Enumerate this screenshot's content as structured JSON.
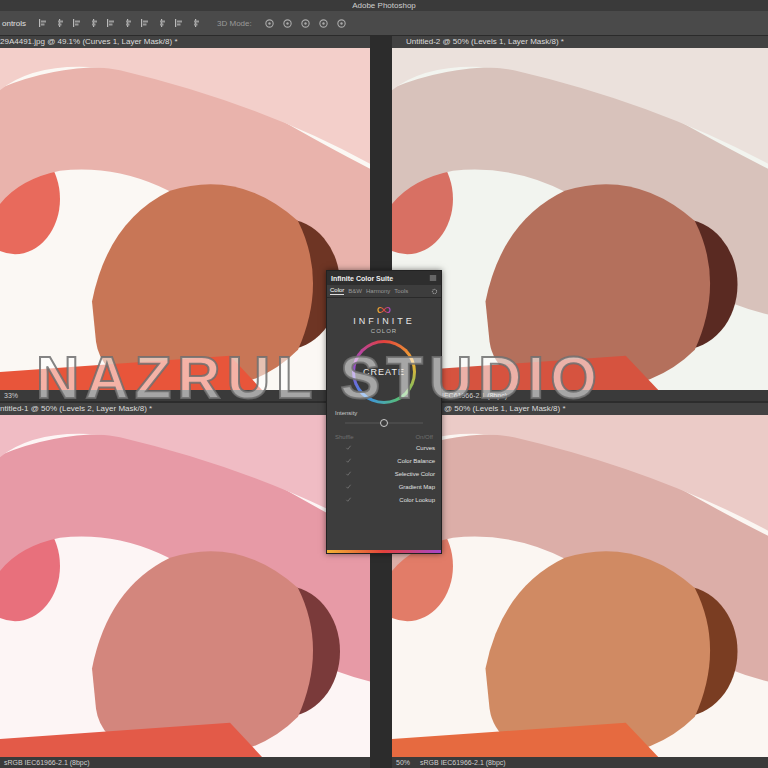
{
  "window": {
    "title": "Adobe Photoshop"
  },
  "options_bar": {
    "label": "ontrols",
    "mode_label": "3D Mode:"
  },
  "documents": [
    {
      "tab": "29A4491.jpg @ 49.1% (Curves 1, Layer Mask/8) *",
      "zoom": "33%",
      "profile": ""
    },
    {
      "tab": "Untitled-2 @ 50% (Levels 1, Layer Mask/8) *",
      "zoom": "",
      "profile": "IEC61966-2.1 (8bpc)"
    },
    {
      "tab": "ntitled-1 @ 50% (Levels 2, Layer Mask/8) *",
      "zoom": "",
      "profile": "sRGB IEC61966-2.1 (8bpc)"
    },
    {
      "tab": "@ 50% (Levels 1, Layer Mask/8) *",
      "zoom": "50%",
      "profile": "sRGB IEC61966-2.1 (8bpc)"
    }
  ],
  "plugin": {
    "title": "Infinite Color Suite",
    "tabs": [
      {
        "label": "Color",
        "selected": true
      },
      {
        "label": "B&W",
        "selected": false
      },
      {
        "label": "Harmony",
        "selected": false
      },
      {
        "label": "Tools",
        "selected": false
      }
    ],
    "logo": {
      "line1": "INFINITE",
      "line2": "COLOR"
    },
    "create": "CREATE",
    "intensity": {
      "label": "Intensity",
      "level": 0.5
    },
    "columns": [
      "Shuffle",
      "On/Off"
    ],
    "adjustments": [
      {
        "label": "Curves",
        "shuffle": true
      },
      {
        "label": "Color Balance",
        "shuffle": true
      },
      {
        "label": "Selective Color",
        "shuffle": true
      },
      {
        "label": "Gradient Map",
        "shuffle": true
      },
      {
        "label": "Color Lookup",
        "shuffle": true
      }
    ]
  },
  "watermark": "NAZRUL STUDIO"
}
